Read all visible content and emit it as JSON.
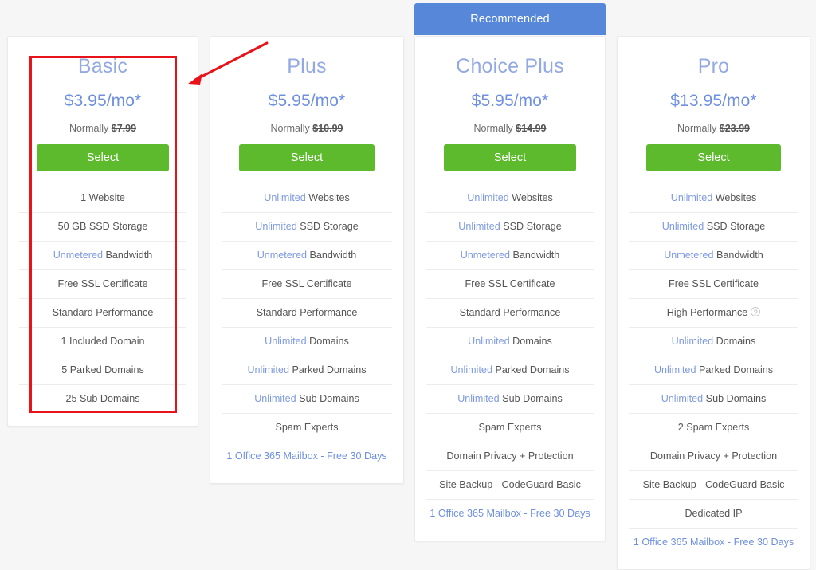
{
  "recommended_badge": "Recommended",
  "plans": [
    {
      "id": "basic",
      "title": "Basic",
      "price": "$3.95/mo*",
      "normally_label": "Normally",
      "normally_price": "$7.99",
      "select_label": "Select",
      "features": [
        {
          "highlight": "",
          "text": "1 Website",
          "style": "plain"
        },
        {
          "highlight": "",
          "text": "50 GB SSD Storage",
          "style": "plain"
        },
        {
          "highlight": "Unmetered",
          "text": " Bandwidth",
          "style": "highlight"
        },
        {
          "highlight": "",
          "text": "Free SSL Certificate",
          "style": "plain"
        },
        {
          "highlight": "",
          "text": "Standard Performance",
          "style": "plain"
        },
        {
          "highlight": "",
          "text": "1 Included Domain",
          "style": "plain"
        },
        {
          "highlight": "",
          "text": "5 Parked Domains",
          "style": "plain"
        },
        {
          "highlight": "",
          "text": "25 Sub Domains",
          "style": "plain"
        }
      ]
    },
    {
      "id": "plus",
      "title": "Plus",
      "price": "$5.95/mo*",
      "normally_label": "Normally",
      "normally_price": "$10.99",
      "select_label": "Select",
      "features": [
        {
          "highlight": "Unlimited",
          "text": " Websites",
          "style": "highlight"
        },
        {
          "highlight": "Unlimited",
          "text": " SSD Storage",
          "style": "highlight"
        },
        {
          "highlight": "Unmetered",
          "text": " Bandwidth",
          "style": "highlight"
        },
        {
          "highlight": "",
          "text": "Free SSL Certificate",
          "style": "plain"
        },
        {
          "highlight": "",
          "text": "Standard Performance",
          "style": "plain"
        },
        {
          "highlight": "Unlimited",
          "text": " Domains",
          "style": "highlight"
        },
        {
          "highlight": "Unlimited",
          "text": " Parked Domains",
          "style": "highlight"
        },
        {
          "highlight": "Unlimited",
          "text": " Sub Domains",
          "style": "highlight"
        },
        {
          "highlight": "",
          "text": "Spam Experts",
          "style": "plain"
        },
        {
          "highlight": "",
          "text": "1 Office 365 Mailbox - Free 30 Days",
          "style": "link"
        }
      ]
    },
    {
      "id": "choice-plus",
      "title": "Choice Plus",
      "price": "$5.95/mo*",
      "normally_label": "Normally",
      "normally_price": "$14.99",
      "select_label": "Select",
      "recommended": true,
      "features": [
        {
          "highlight": "Unlimited",
          "text": " Websites",
          "style": "highlight"
        },
        {
          "highlight": "Unlimited",
          "text": " SSD Storage",
          "style": "highlight"
        },
        {
          "highlight": "Unmetered",
          "text": " Bandwidth",
          "style": "highlight"
        },
        {
          "highlight": "",
          "text": "Free SSL Certificate",
          "style": "plain"
        },
        {
          "highlight": "",
          "text": "Standard Performance",
          "style": "plain"
        },
        {
          "highlight": "Unlimited",
          "text": " Domains",
          "style": "highlight"
        },
        {
          "highlight": "Unlimited",
          "text": " Parked Domains",
          "style": "highlight"
        },
        {
          "highlight": "Unlimited",
          "text": " Sub Domains",
          "style": "highlight"
        },
        {
          "highlight": "",
          "text": "Spam Experts",
          "style": "plain"
        },
        {
          "highlight": "",
          "text": "Domain Privacy + Protection",
          "style": "plain"
        },
        {
          "highlight": "",
          "text": "Site Backup - CodeGuard Basic",
          "style": "plain"
        },
        {
          "highlight": "",
          "text": "1 Office 365 Mailbox - Free 30 Days",
          "style": "link"
        }
      ]
    },
    {
      "id": "pro",
      "title": "Pro",
      "price": "$13.95/mo*",
      "normally_label": "Normally",
      "normally_price": "$23.99",
      "select_label": "Select",
      "features": [
        {
          "highlight": "Unlimited",
          "text": " Websites",
          "style": "highlight"
        },
        {
          "highlight": "Unlimited",
          "text": " SSD Storage",
          "style": "highlight"
        },
        {
          "highlight": "Unmetered",
          "text": " Bandwidth",
          "style": "highlight"
        },
        {
          "highlight": "",
          "text": "Free SSL Certificate",
          "style": "plain"
        },
        {
          "highlight": "",
          "text": "High Performance",
          "style": "plain",
          "info": "?"
        },
        {
          "highlight": "Unlimited",
          "text": " Domains",
          "style": "highlight"
        },
        {
          "highlight": "Unlimited",
          "text": " Parked Domains",
          "style": "highlight"
        },
        {
          "highlight": "Unlimited",
          "text": " Sub Domains",
          "style": "highlight"
        },
        {
          "highlight": "",
          "text": "2 Spam Experts",
          "style": "plain"
        },
        {
          "highlight": "",
          "text": "Domain Privacy + Protection",
          "style": "plain"
        },
        {
          "highlight": "",
          "text": "Site Backup - CodeGuard Basic",
          "style": "plain"
        },
        {
          "highlight": "",
          "text": "Dedicated IP",
          "style": "plain"
        },
        {
          "highlight": "",
          "text": "1 Office 365 Mailbox - Free 30 Days",
          "style": "link"
        }
      ]
    }
  ],
  "annotation": {
    "box_target": "basic",
    "arrow_color": "#e8131a",
    "box_color": "#e8131a"
  },
  "colors": {
    "title_blue": "#93a9e2",
    "price_blue": "#6f90e0",
    "select_green": "#5dba2c",
    "recommended_blue": "#5687d8",
    "feature_text": "#555555",
    "highlight_blue": "#7e9ae0",
    "page_background": "#f6f6f6"
  }
}
